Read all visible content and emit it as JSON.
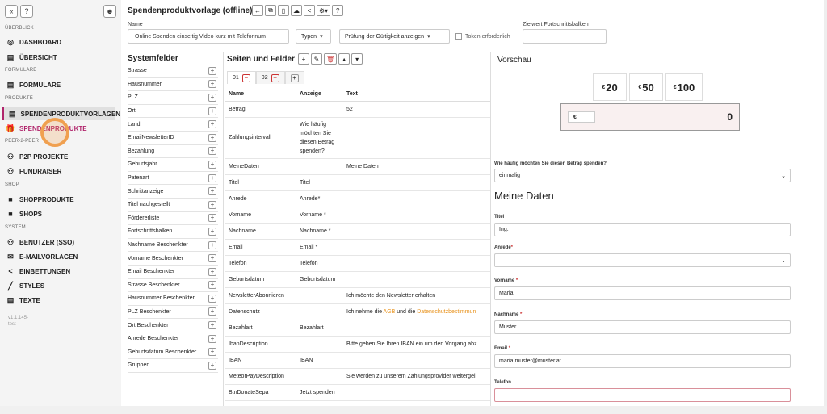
{
  "sidebar": {
    "sections": {
      "overview": "ÜBERBLICK",
      "forms": "FORMULARE",
      "products": "PRODUKTE",
      "p2p": "PEER-2-PEER",
      "shop": "SHOP",
      "system": "SYSTEM"
    },
    "items": {
      "dashboard": "DASHBOARD",
      "overview": "ÜBERSICHT",
      "forms": "FORMULARE",
      "donation_templates": "SPENDENPRODUKTVORLAGEN",
      "donation_products": "SPENDENPRODUKTE",
      "p2p_projects": "P2P PROJEKTE",
      "fundraiser": "FUNDRAISER",
      "shop_products": "SHOPPRODUKTE",
      "shops": "SHOPS",
      "users": "BENUTZER (SSO)",
      "email_templates": "E-MAILVORLAGEN",
      "embeddings": "EINBETTUNGEN",
      "styles": "STYLES",
      "texts": "TEXTE"
    },
    "version_line1": "v1.1.145-",
    "version_line2": "test"
  },
  "header": {
    "title": "Spendenproduktvorlage (offline)",
    "name_label": "Name",
    "name_value": "Online Spenden einseitig Video kurz mit Telefonnum",
    "types_label": "Typen",
    "validity_label": "Prüfung der Gültigkeit anzeigen",
    "token_label": "Token erforderlich",
    "target_label": "Zielwert Fortschrittsbalken"
  },
  "system_fields": {
    "title": "Systemfelder",
    "items": [
      "Strasse",
      "Hausnummer",
      "PLZ",
      "Ort",
      "Land",
      "EmailNewsletterID",
      "Bezahlung",
      "Geburtsjahr",
      "Patenart",
      "Schrittanzeige",
      "Titel nachgestellt",
      "Fördererliste",
      "Fortschrittsbalken",
      "Nachname Beschenkter",
      "Vorname Beschenkter",
      "Email Beschenkter",
      "Strasse Beschenkter",
      "Hausnummer Beschenkter",
      "PLZ Beschenkter",
      "Ort Beschenkter",
      "Anrede Beschenkter",
      "Geburtsdatum Beschenkter",
      "Gruppen"
    ]
  },
  "fields": {
    "title": "Seiten und Felder",
    "tabs": [
      "01",
      "02"
    ],
    "headers": [
      "Name",
      "Anzeige",
      "Text"
    ],
    "rows": [
      [
        "Betrag",
        "",
        "52"
      ],
      [
        "Zahlungsintervall",
        "Wie häufig möchten Sie diesen Betrag spenden?",
        ""
      ],
      [
        "MeineDaten",
        "",
        "Meine Daten"
      ],
      [
        "Titel",
        "Titel",
        ""
      ],
      [
        "Anrede",
        "Anrede*",
        ""
      ],
      [
        "Vorname",
        "Vorname *",
        ""
      ],
      [
        "Nachname",
        "Nachname *",
        ""
      ],
      [
        "Email",
        "Email *",
        ""
      ],
      [
        "Telefon",
        "Telefon",
        ""
      ],
      [
        "Geburtsdatum",
        "Geburtsdatum",
        ""
      ],
      [
        "NewsletterAbonnieren",
        "",
        "Ich möchte den Newsletter erhalten"
      ],
      [
        "Datenschutz",
        "",
        "Ich nehme die AGB und die Datenschutzbestimmun"
      ],
      [
        "Bezahlart",
        "Bezahlart",
        ""
      ],
      [
        "IbanDescription",
        "",
        "Bitte geben Sie Ihren IBAN ein um den Vorgang abz"
      ],
      [
        "IBAN",
        "IBAN",
        ""
      ],
      [
        "MeteorPayDescription",
        "",
        "Sie werden zu unserem Zahlungsprovider weitergel"
      ],
      [
        "BtnDonateSepa",
        "Jetzt spenden",
        ""
      ]
    ],
    "datenschutz": {
      "pre": "Ich nehme die ",
      "agb": "AGB",
      "mid": " und die ",
      "ds": "Datenschutzbestimmun"
    }
  },
  "preview": {
    "title": "Vorschau",
    "amounts": [
      {
        "cur": "€",
        "val": "20"
      },
      {
        "cur": "€",
        "val": "50"
      },
      {
        "cur": "€",
        "val": "100"
      }
    ],
    "currency": "€",
    "amount_value": "0",
    "interval_label": "Wie häufig möchten Sie diesen Betrag spenden?",
    "interval_value": "einmalig",
    "section_title": "Meine Daten",
    "title_label": "Titel",
    "title_value": "Ing.",
    "salutation_label": "Anrede",
    "salutation_value": "",
    "firstname_label": "Vorname",
    "firstname_value": "Maria",
    "lastname_label": "Nachname",
    "lastname_value": "Muster",
    "email_label": "Email",
    "email_value": "maria.muster@muster.at",
    "phone_label": "Telefon",
    "phone_value": "",
    "required_mark": "*"
  }
}
